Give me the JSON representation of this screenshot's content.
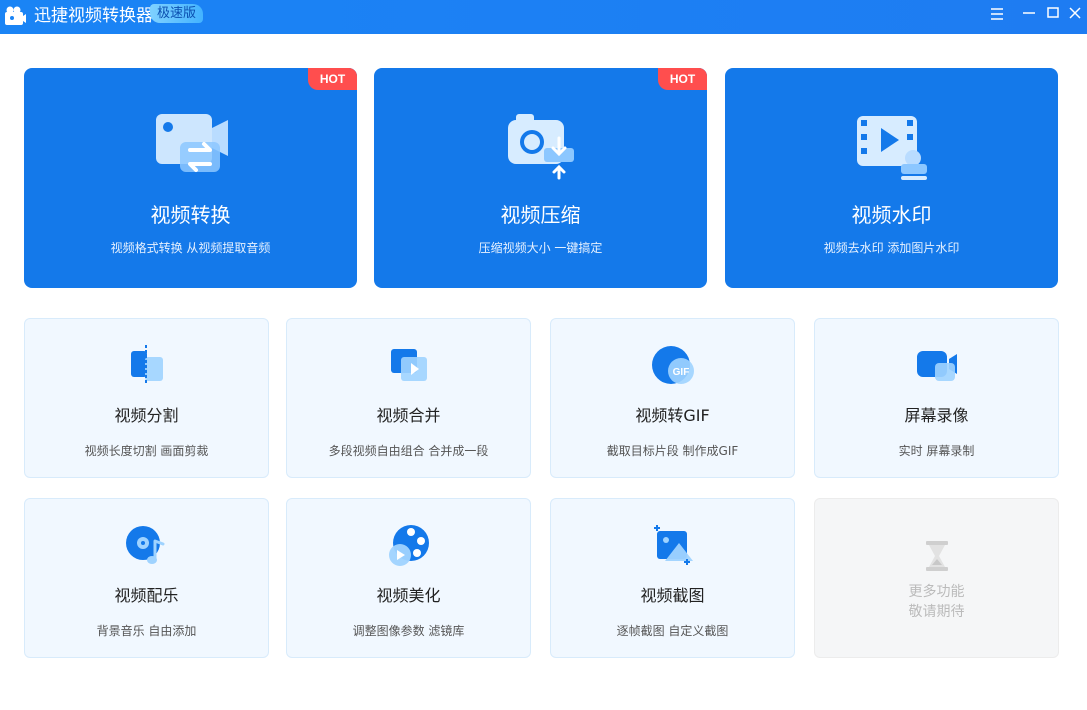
{
  "app": {
    "title": "迅捷视频转换器",
    "edition": "极速版",
    "accent_color": "#1479ea",
    "hot_color": "#ff4e4e"
  },
  "window_controls": {
    "menu_icon": "menu-icon",
    "minimize_icon": "minimize-icon",
    "maximize_icon": "maximize-icon",
    "close_icon": "close-icon"
  },
  "featured": [
    {
      "title": "视频转换",
      "desc": "视频格式转换 从视频提取音频",
      "badge": "HOT",
      "icon": "video-convert-icon"
    },
    {
      "title": "视频压缩",
      "desc": "压缩视频大小 一键搞定",
      "badge": "HOT",
      "icon": "video-compress-icon"
    },
    {
      "title": "视频水印",
      "desc": "视频去水印 添加图片水印",
      "badge": "",
      "icon": "video-watermark-icon"
    }
  ],
  "tools": [
    {
      "title": "视频分割",
      "desc": "视频长度切割 画面剪裁",
      "icon": "video-split-icon"
    },
    {
      "title": "视频合并",
      "desc": "多段视频自由组合 合并成一段",
      "icon": "video-merge-icon"
    },
    {
      "title": "视频转GIF",
      "desc": "截取目标片段 制作成GIF",
      "icon": "video-to-gif-icon"
    },
    {
      "title": "屏幕录像",
      "desc": "实时 屏幕录制",
      "icon": "screen-record-icon"
    },
    {
      "title": "视频配乐",
      "desc": "背景音乐 自由添加",
      "icon": "video-music-icon"
    },
    {
      "title": "视频美化",
      "desc": "调整图像参数 滤镜库",
      "icon": "video-beautify-icon"
    },
    {
      "title": "视频截图",
      "desc": "逐帧截图 自定义截图",
      "icon": "video-screenshot-icon"
    }
  ],
  "more": {
    "line1": "更多功能",
    "line2": "敬请期待",
    "icon": "hourglass-icon"
  }
}
